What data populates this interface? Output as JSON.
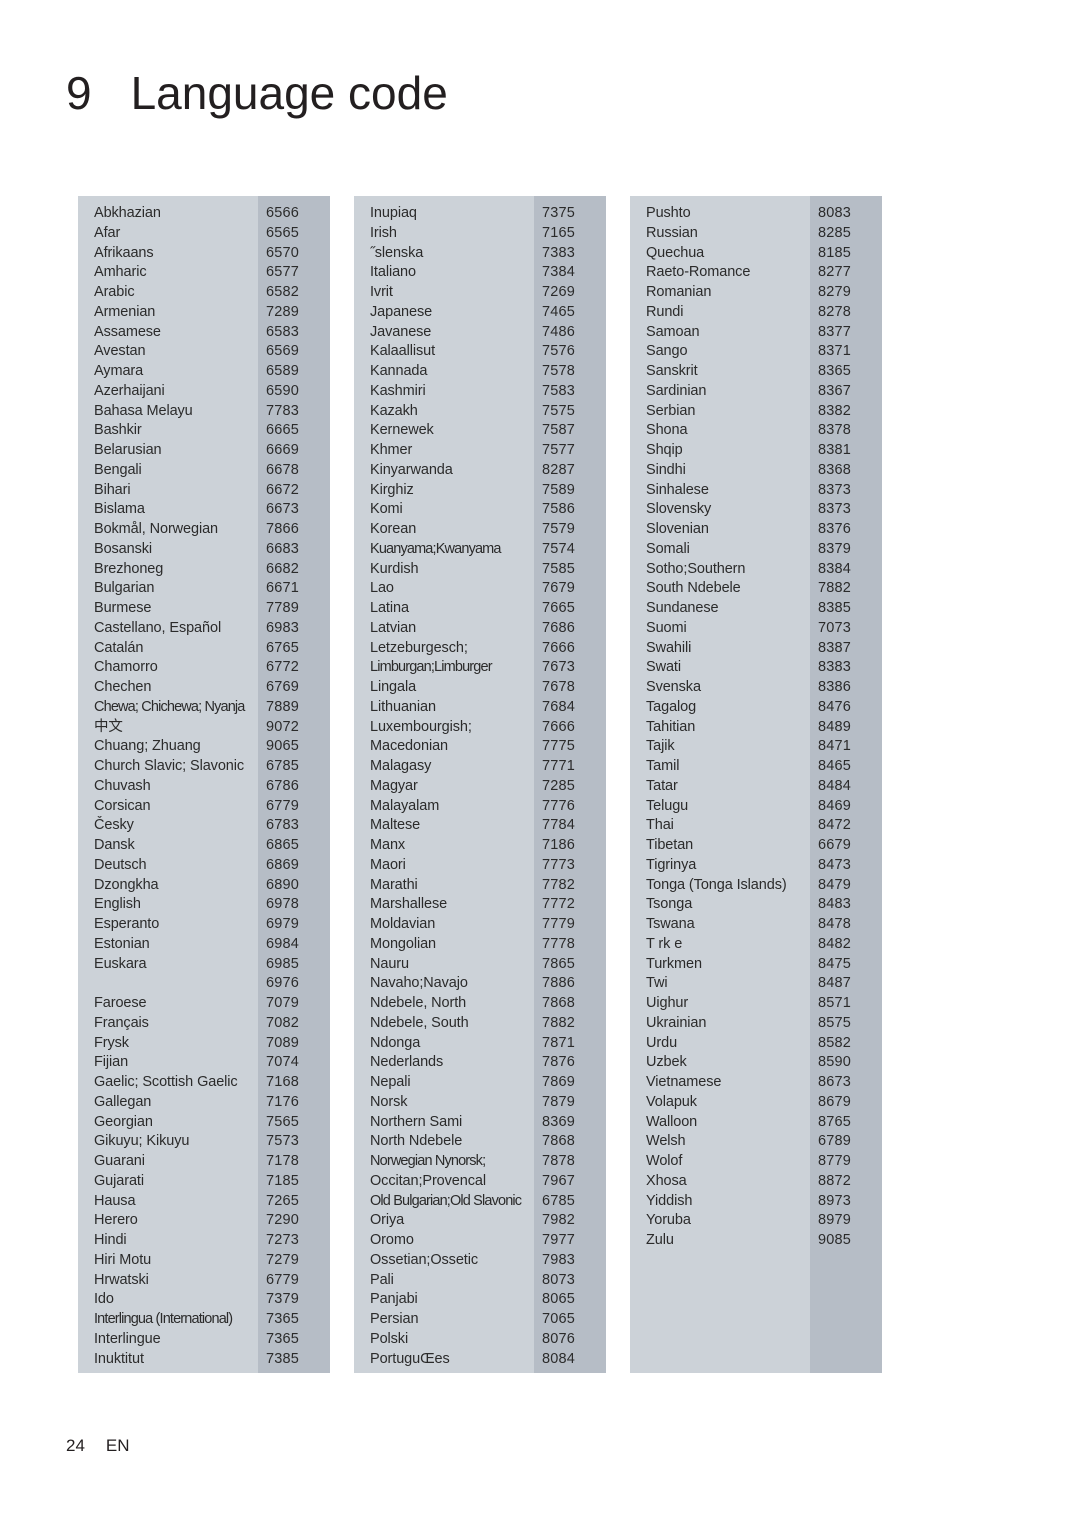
{
  "header": {
    "chapter_number": "9",
    "title": "Language code"
  },
  "footer": {
    "page_number": "24",
    "locale": "EN"
  },
  "colors": {
    "panel_background": "#ccd2d8",
    "code_strip_background": "#b6bdc6",
    "text": "#2b2b2b",
    "heading": "#231f20",
    "page_background": "#ffffff"
  },
  "table": {
    "columns": [
      {
        "column_index": 1,
        "rows": [
          {
            "language": "Abkhazian",
            "code": "6566"
          },
          {
            "language": "Afar",
            "code": "6565"
          },
          {
            "language": "Afrikaans",
            "code": "6570"
          },
          {
            "language": "Amharic",
            "code": "6577"
          },
          {
            "language": "Arabic",
            "code": "6582"
          },
          {
            "language": "Armenian",
            "code": "7289"
          },
          {
            "language": "Assamese",
            "code": "6583"
          },
          {
            "language": "Avestan",
            "code": "6569"
          },
          {
            "language": "Aymara",
            "code": "6589"
          },
          {
            "language": "Azerhaijani",
            "code": "6590"
          },
          {
            "language": "Bahasa Melayu",
            "code": "7783"
          },
          {
            "language": "Bashkir",
            "code": "6665"
          },
          {
            "language": "Belarusian",
            "code": "6669"
          },
          {
            "language": "Bengali",
            "code": "6678"
          },
          {
            "language": "Bihari",
            "code": "6672"
          },
          {
            "language": "Bislama",
            "code": "6673"
          },
          {
            "language": "Bokmål, Norwegian",
            "code": "7866"
          },
          {
            "language": "Bosanski",
            "code": "6683"
          },
          {
            "language": "Brezhoneg",
            "code": "6682"
          },
          {
            "language": "Bulgarian",
            "code": "6671"
          },
          {
            "language": "Burmese",
            "code": "7789"
          },
          {
            "language": "Castellano, Español",
            "code": "6983"
          },
          {
            "language": "Catalán",
            "code": "6765"
          },
          {
            "language": "Chamorro",
            "code": "6772"
          },
          {
            "language": "Chechen",
            "code": "6769"
          },
          {
            "language": "Chewa; Chichewa; Nyanja",
            "code": "7889",
            "squeeze": true
          },
          {
            "language": "中文",
            "code": "9072"
          },
          {
            "language": "Chuang; Zhuang",
            "code": "9065"
          },
          {
            "language": "Church Slavic; Slavonic",
            "code": "6785"
          },
          {
            "language": "Chuvash",
            "code": "6786"
          },
          {
            "language": "Corsican",
            "code": "6779"
          },
          {
            "language": "Česky",
            "code": "6783"
          },
          {
            "language": "Dansk",
            "code": "6865"
          },
          {
            "language": "Deutsch",
            "code": "6869"
          },
          {
            "language": "Dzongkha",
            "code": "6890"
          },
          {
            "language": "English",
            "code": "6978"
          },
          {
            "language": "Esperanto",
            "code": "6979"
          },
          {
            "language": "Estonian",
            "code": "6984"
          },
          {
            "language": "Euskara",
            "code": "6985"
          },
          {
            "language": "",
            "code": "6976"
          },
          {
            "language": "Faroese",
            "code": "7079"
          },
          {
            "language": "Français",
            "code": "7082"
          },
          {
            "language": "Frysk",
            "code": "7089"
          },
          {
            "language": "Fijian",
            "code": "7074"
          },
          {
            "language": "Gaelic; Scottish Gaelic",
            "code": "7168"
          },
          {
            "language": "Gallegan",
            "code": "7176"
          },
          {
            "language": "Georgian",
            "code": "7565"
          },
          {
            "language": "Gikuyu; Kikuyu",
            "code": "7573"
          },
          {
            "language": "Guarani",
            "code": "7178"
          },
          {
            "language": "Gujarati",
            "code": "7185"
          },
          {
            "language": "Hausa",
            "code": "7265"
          },
          {
            "language": "Herero",
            "code": "7290"
          },
          {
            "language": "Hindi",
            "code": "7273"
          },
          {
            "language": "Hiri Motu",
            "code": "7279"
          },
          {
            "language": "Hrwatski",
            "code": "6779"
          },
          {
            "language": "Ido",
            "code": "7379"
          },
          {
            "language": "Interlingua (International)",
            "code": "7365",
            "squeeze": true
          },
          {
            "language": "Interlingue",
            "code": "7365"
          },
          {
            "language": "Inuktitut",
            "code": "7385"
          }
        ]
      },
      {
        "column_index": 2,
        "rows": [
          {
            "language": "Inupiaq",
            "code": "7375"
          },
          {
            "language": "Irish",
            "code": "7165"
          },
          {
            "language": "˝slenska",
            "code": "7383"
          },
          {
            "language": "Italiano",
            "code": "7384"
          },
          {
            "language": "Ivrit",
            "code": "7269"
          },
          {
            "language": "Japanese",
            "code": "7465"
          },
          {
            "language": "Javanese",
            "code": "7486"
          },
          {
            "language": "Kalaallisut",
            "code": "7576"
          },
          {
            "language": "Kannada",
            "code": "7578"
          },
          {
            "language": "Kashmiri",
            "code": "7583"
          },
          {
            "language": "Kazakh",
            "code": "7575"
          },
          {
            "language": "Kernewek",
            "code": "7587"
          },
          {
            "language": "Khmer",
            "code": "7577"
          },
          {
            "language": "Kinyarwanda",
            "code": "8287"
          },
          {
            "language": "Kirghiz",
            "code": "7589"
          },
          {
            "language": "Komi",
            "code": "7586"
          },
          {
            "language": "Korean",
            "code": "7579"
          },
          {
            "language": "Kuanyama;Kwanyama",
            "code": "7574",
            "squeeze": true
          },
          {
            "language": "Kurdish",
            "code": "7585"
          },
          {
            "language": "Lao",
            "code": "7679"
          },
          {
            "language": "Latina",
            "code": "7665"
          },
          {
            "language": "Latvian",
            "code": "7686"
          },
          {
            "language": "Letzeburgesch;",
            "code": "7666"
          },
          {
            "language": "Limburgan;Limburger",
            "code": "7673",
            "squeeze": true
          },
          {
            "language": "Lingala",
            "code": "7678"
          },
          {
            "language": "Lithuanian",
            "code": "7684"
          },
          {
            "language": "Luxembourgish;",
            "code": "7666"
          },
          {
            "language": "Macedonian",
            "code": "7775"
          },
          {
            "language": "Malagasy",
            "code": "7771"
          },
          {
            "language": "Magyar",
            "code": "7285"
          },
          {
            "language": "Malayalam",
            "code": "7776"
          },
          {
            "language": "Maltese",
            "code": "7784"
          },
          {
            "language": "Manx",
            "code": "7186"
          },
          {
            "language": "Maori",
            "code": "7773"
          },
          {
            "language": "Marathi",
            "code": "7782"
          },
          {
            "language": "Marshallese",
            "code": "7772"
          },
          {
            "language": "Moldavian",
            "code": "7779"
          },
          {
            "language": "Mongolian",
            "code": "7778"
          },
          {
            "language": "Nauru",
            "code": "7865"
          },
          {
            "language": "Navaho;Navajo",
            "code": "7886"
          },
          {
            "language": "Ndebele, North",
            "code": "7868"
          },
          {
            "language": "Ndebele, South",
            "code": "7882"
          },
          {
            "language": "Ndonga",
            "code": "7871"
          },
          {
            "language": "Nederlands",
            "code": "7876"
          },
          {
            "language": "Nepali",
            "code": "7869"
          },
          {
            "language": "Norsk",
            "code": "7879"
          },
          {
            "language": "Northern Sami",
            "code": "8369"
          },
          {
            "language": "North Ndebele",
            "code": "7868"
          },
          {
            "language": "Norwegian Nynorsk;",
            "code": "7878",
            "squeeze": true
          },
          {
            "language": "Occitan;Provencal",
            "code": "7967"
          },
          {
            "language": "Old Bulgarian;Old Slavonic",
            "code": "6785",
            "squeeze": true
          },
          {
            "language": "Oriya",
            "code": "7982"
          },
          {
            "language": "Oromo",
            "code": "7977"
          },
          {
            "language": "Ossetian;Ossetic",
            "code": "7983"
          },
          {
            "language": "Pali",
            "code": "8073"
          },
          {
            "language": "Panjabi",
            "code": "8065"
          },
          {
            "language": "Persian",
            "code": "7065"
          },
          {
            "language": "Polski",
            "code": "8076"
          },
          {
            "language": "PortuguŒes",
            "code": "8084"
          }
        ]
      },
      {
        "column_index": 3,
        "rows": [
          {
            "language": "Pushto",
            "code": "8083"
          },
          {
            "language": "Russian",
            "code": "8285"
          },
          {
            "language": "Quechua",
            "code": "8185"
          },
          {
            "language": "Raeto-Romance",
            "code": "8277"
          },
          {
            "language": "Romanian",
            "code": "8279"
          },
          {
            "language": "Rundi",
            "code": "8278"
          },
          {
            "language": "Samoan",
            "code": "8377"
          },
          {
            "language": "Sango",
            "code": "8371"
          },
          {
            "language": "Sanskrit",
            "code": "8365"
          },
          {
            "language": "Sardinian",
            "code": "8367"
          },
          {
            "language": "Serbian",
            "code": "8382"
          },
          {
            "language": "Shona",
            "code": "8378"
          },
          {
            "language": "Shqip",
            "code": "8381"
          },
          {
            "language": "Sindhi",
            "code": "8368"
          },
          {
            "language": "Sinhalese",
            "code": "8373"
          },
          {
            "language": "Slovensky",
            "code": "8373"
          },
          {
            "language": "Slovenian",
            "code": "8376"
          },
          {
            "language": "Somali",
            "code": "8379"
          },
          {
            "language": "Sotho;Southern",
            "code": "8384"
          },
          {
            "language": "South Ndebele",
            "code": "7882"
          },
          {
            "language": "Sundanese",
            "code": "8385"
          },
          {
            "language": "Suomi",
            "code": "7073"
          },
          {
            "language": "Swahili",
            "code": "8387"
          },
          {
            "language": "Swati",
            "code": "8383"
          },
          {
            "language": "Svenska",
            "code": "8386"
          },
          {
            "language": "Tagalog",
            "code": "8476"
          },
          {
            "language": "Tahitian",
            "code": "8489"
          },
          {
            "language": "Tajik",
            "code": "8471"
          },
          {
            "language": "Tamil",
            "code": "8465"
          },
          {
            "language": "Tatar",
            "code": "8484"
          },
          {
            "language": "Telugu",
            "code": "8469"
          },
          {
            "language": "Thai",
            "code": "8472"
          },
          {
            "language": "Tibetan",
            "code": "6679"
          },
          {
            "language": "Tigrinya",
            "code": "8473"
          },
          {
            "language": "Tonga (Tonga Islands)",
            "code": "8479"
          },
          {
            "language": "Tsonga",
            "code": "8483"
          },
          {
            "language": "Tswana",
            "code": "8478"
          },
          {
            "language": "T rk e",
            "code": "8482"
          },
          {
            "language": "Turkmen",
            "code": "8475"
          },
          {
            "language": "Twi",
            "code": "8487"
          },
          {
            "language": "Uighur",
            "code": "8571"
          },
          {
            "language": "Ukrainian",
            "code": "8575"
          },
          {
            "language": "Urdu",
            "code": "8582"
          },
          {
            "language": "Uzbek",
            "code": "8590"
          },
          {
            "language": "Vietnamese",
            "code": "8673"
          },
          {
            "language": "Volapuk",
            "code": "8679"
          },
          {
            "language": "Walloon",
            "code": "8765"
          },
          {
            "language": "Welsh",
            "code": "6789"
          },
          {
            "language": "Wolof",
            "code": "8779"
          },
          {
            "language": "Xhosa",
            "code": "8872"
          },
          {
            "language": "Yiddish",
            "code": "8973"
          },
          {
            "language": "Yoruba",
            "code": "8979"
          },
          {
            "language": "Zulu",
            "code": "9085"
          }
        ]
      }
    ]
  }
}
